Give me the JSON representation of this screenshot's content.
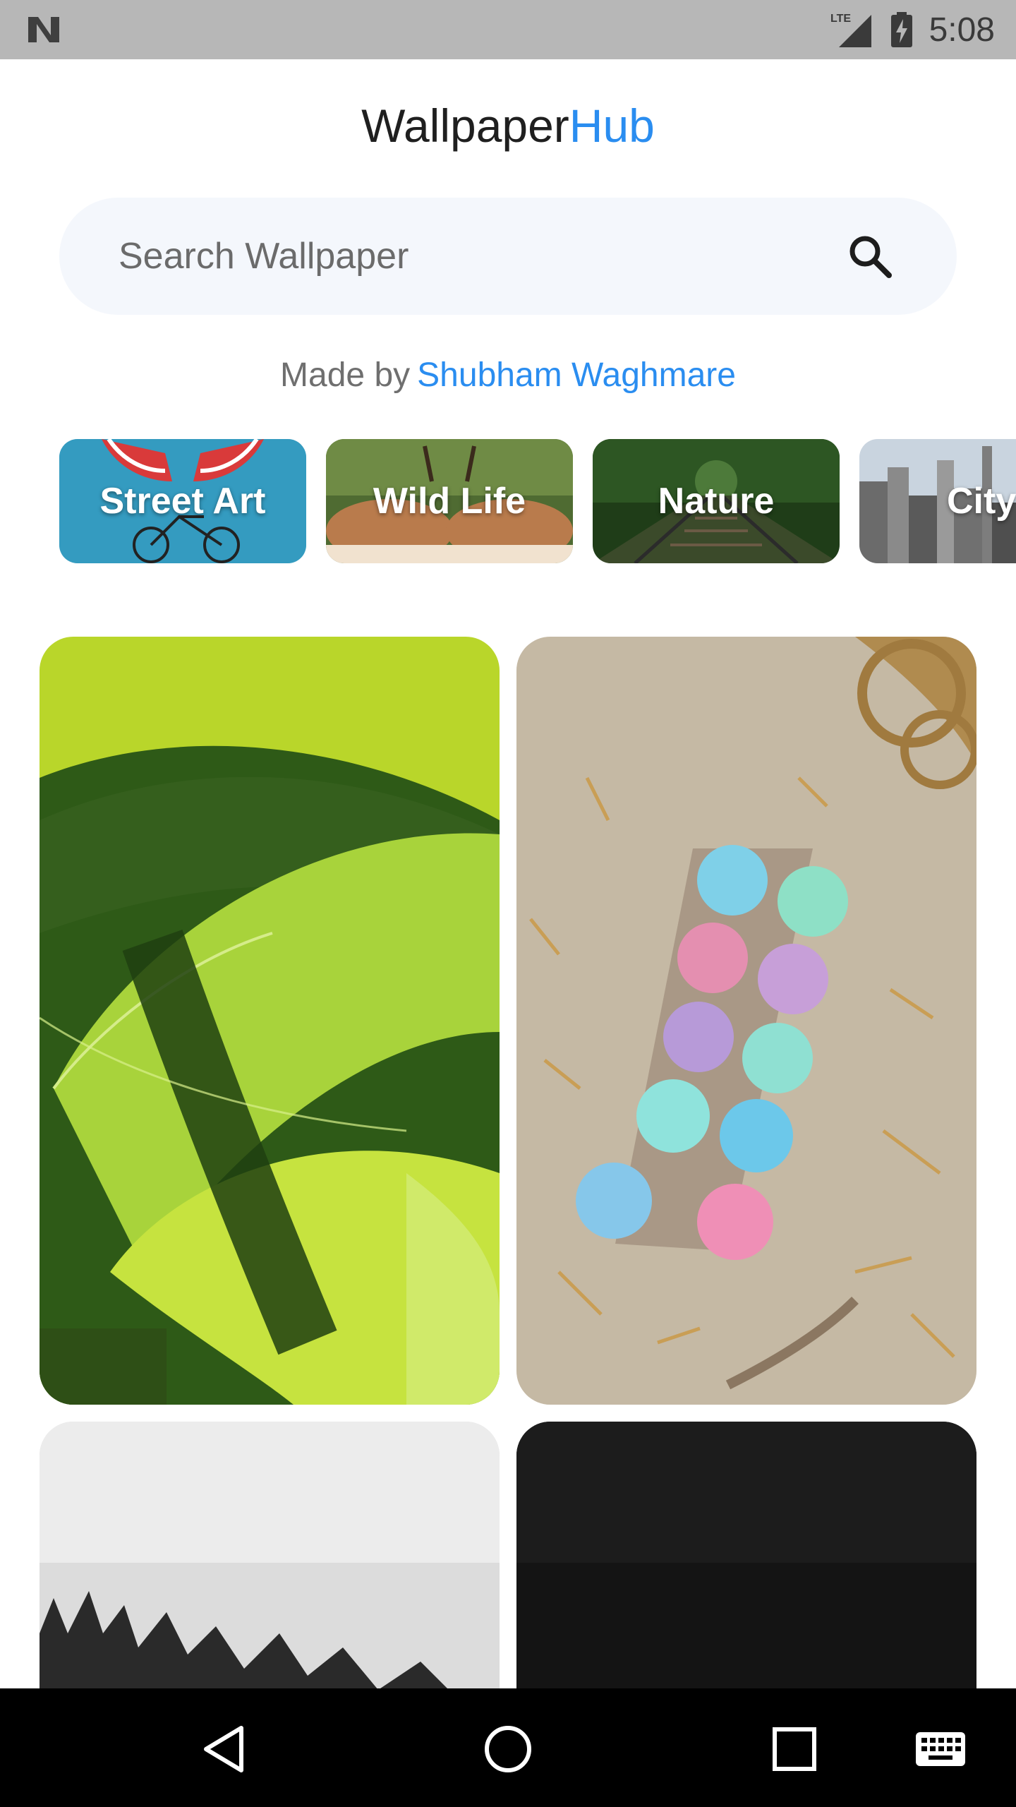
{
  "status_bar": {
    "network": "LTE",
    "time": "5:08",
    "icons": [
      "notification-n-icon",
      "lte-signal-icon",
      "battery-charging-icon"
    ]
  },
  "header": {
    "title_part1": "Wallpaper",
    "title_part2": "Hub",
    "accent_color": "#2a8df0"
  },
  "search": {
    "placeholder": "Search Wallpaper",
    "icon": "search-icon"
  },
  "credit": {
    "prefix": "Made by",
    "author": "Shubham Waghmare"
  },
  "categories": [
    {
      "label": "Street Art"
    },
    {
      "label": "Wild Life"
    },
    {
      "label": "Nature"
    },
    {
      "label": "City"
    }
  ],
  "wallpapers": [
    {
      "subject": "green-leaves"
    },
    {
      "subject": "easter-eggs"
    },
    {
      "subject": "grass-bw"
    },
    {
      "subject": "dark-texture"
    }
  ],
  "nav_bar": {
    "icons": [
      "back-icon",
      "home-icon",
      "recents-icon",
      "keyboard-icon"
    ]
  }
}
